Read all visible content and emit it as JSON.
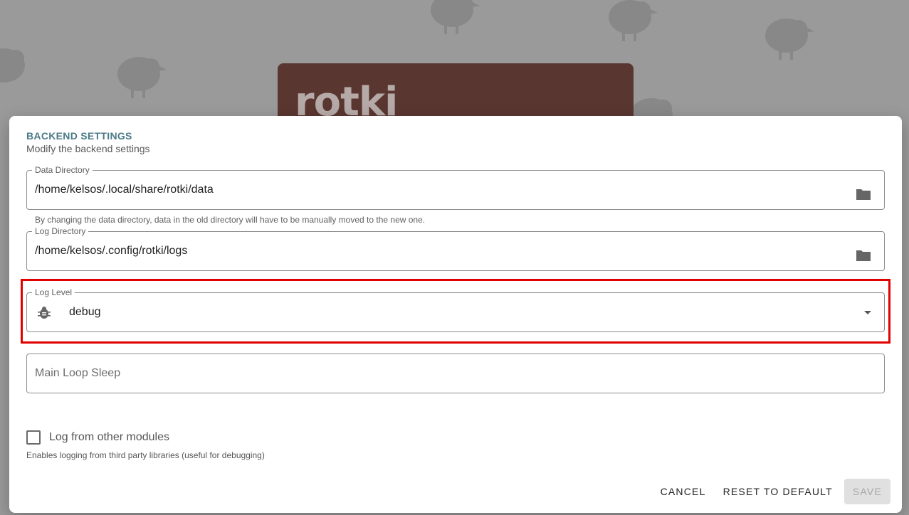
{
  "background": {
    "logo_text": "rotki"
  },
  "dialog": {
    "title": "BACKEND SETTINGS",
    "subtitle": "Modify the backend settings",
    "data_directory": {
      "label": "Data Directory",
      "value": "/home/kelsos/.local/share/rotki/data",
      "hint": "By changing the data directory, data in the old directory will have to be manually moved to the new one.",
      "icon": "folder-icon"
    },
    "log_directory": {
      "label": "Log Directory",
      "value": "/home/kelsos/.config/rotki/logs",
      "icon": "folder-icon"
    },
    "log_level": {
      "label": "Log Level",
      "value": "debug",
      "icon": "bug-icon"
    },
    "main_loop_sleep": {
      "placeholder": "Main Loop Sleep"
    },
    "log_other_modules": {
      "label": "Log from other modules",
      "checked": false,
      "hint": "Enables logging from third party libraries (useful for debugging)"
    },
    "actions": {
      "cancel": "CANCEL",
      "reset": "RESET TO DEFAULT",
      "save": "SAVE"
    }
  },
  "colors": {
    "title": "#4a7a86",
    "highlight": "#e00000",
    "logo_card": "#5a3630"
  }
}
